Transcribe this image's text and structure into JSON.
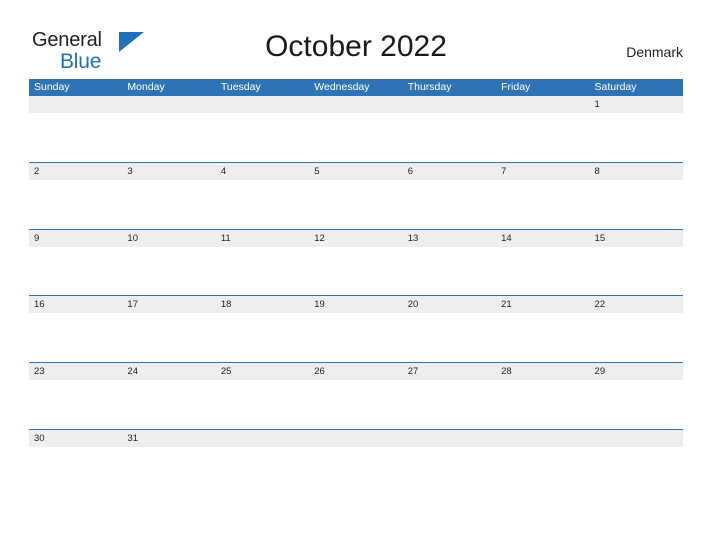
{
  "brand": {
    "name_top": "General",
    "name_bottom": "Blue",
    "triangle_color": "#1f71b8",
    "text_color": "#231f20"
  },
  "header": {
    "title": "October 2022",
    "region": "Denmark"
  },
  "theme": {
    "header_blue": "#2e74b5",
    "row_line_blue": "#2e74b5",
    "date_strip_gray": "#eeeeee",
    "page_background": "#ffffff",
    "text_dark": "#231f20"
  },
  "calendar": {
    "month": "October",
    "year": "2022",
    "weekday_headers": [
      "Sunday",
      "Monday",
      "Tuesday",
      "Wednesday",
      "Thursday",
      "Friday",
      "Saturday"
    ],
    "weeks": [
      [
        "",
        "",
        "",
        "",
        "",
        "",
        "1"
      ],
      [
        "2",
        "3",
        "4",
        "5",
        "6",
        "7",
        "8"
      ],
      [
        "9",
        "10",
        "11",
        "12",
        "13",
        "14",
        "15"
      ],
      [
        "16",
        "17",
        "18",
        "19",
        "20",
        "21",
        "22"
      ],
      [
        "23",
        "24",
        "25",
        "26",
        "27",
        "28",
        "29"
      ],
      [
        "30",
        "31",
        "",
        "",
        "",
        "",
        ""
      ]
    ]
  }
}
